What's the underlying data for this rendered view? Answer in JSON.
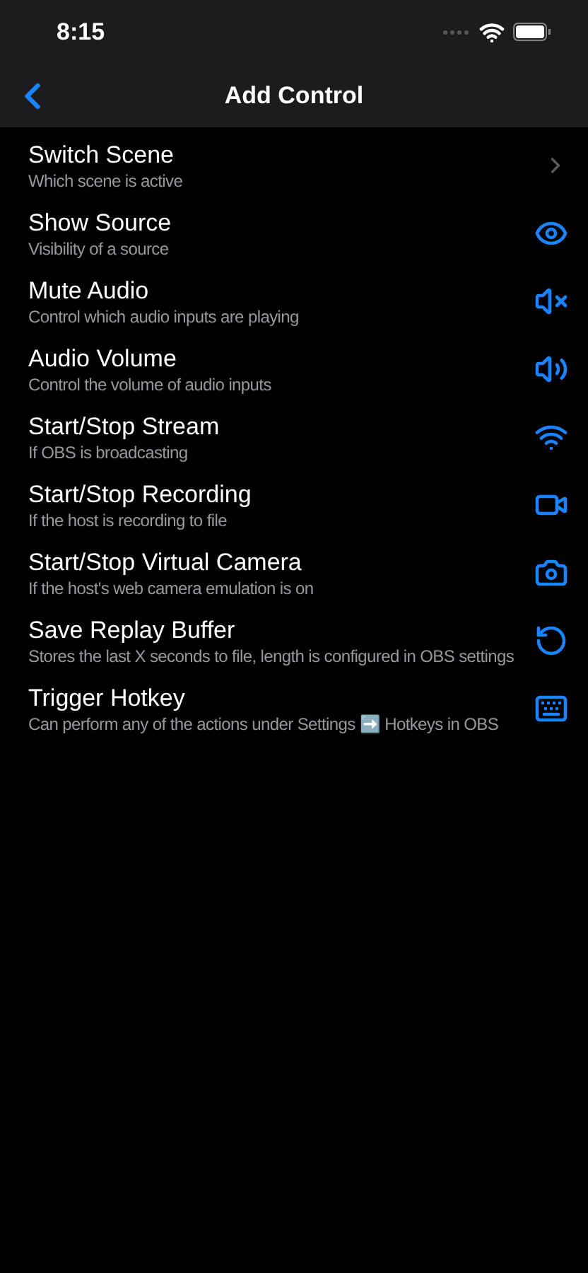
{
  "status_bar": {
    "time": "8:15"
  },
  "nav": {
    "title": "Add Control"
  },
  "items": [
    {
      "title": "Switch Scene",
      "subtitle": "Which scene is active",
      "kind": "chevron"
    },
    {
      "title": "Show Source",
      "subtitle": "Visibility of a source",
      "kind": "eye"
    },
    {
      "title": "Mute Audio",
      "subtitle": "Control which audio inputs are playing",
      "kind": "mute"
    },
    {
      "title": "Audio Volume",
      "subtitle": "Control the volume of audio inputs",
      "kind": "volume"
    },
    {
      "title": "Start/Stop Stream",
      "subtitle": "If OBS is broadcasting",
      "kind": "wifi"
    },
    {
      "title": "Start/Stop Recording",
      "subtitle": "If the host is recording to file",
      "kind": "video"
    },
    {
      "title": "Start/Stop Virtual Camera",
      "subtitle": "If the host's web camera emulation is on",
      "kind": "camera"
    },
    {
      "title": "Save Replay Buffer",
      "subtitle": "Stores the last X seconds to file, length is configured in OBS settings",
      "kind": "replay"
    },
    {
      "title": "Trigger Hotkey",
      "subtitle": "Can perform any of the actions under Settings ➡️ Hotkeys in OBS",
      "kind": "keyboard"
    }
  ]
}
